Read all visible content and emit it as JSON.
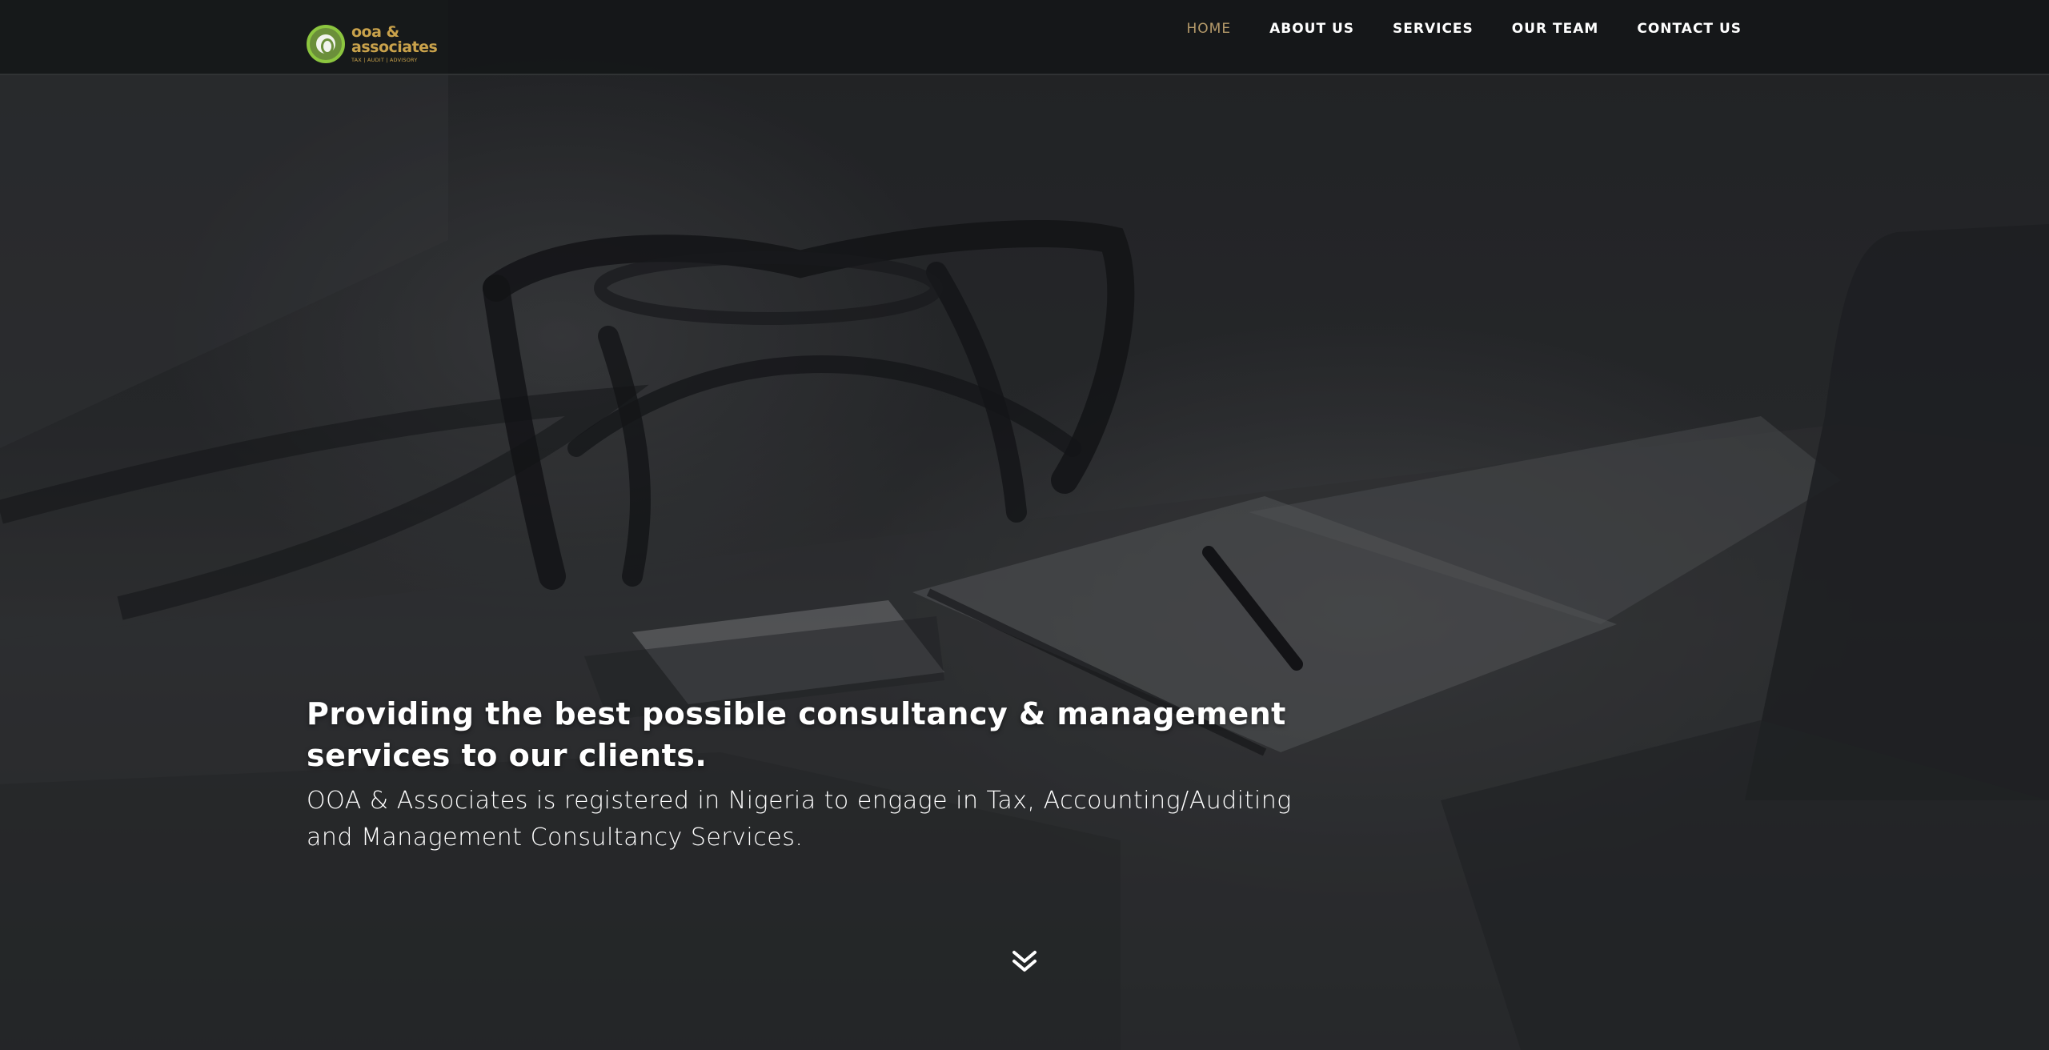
{
  "brand": {
    "logo_line1": "ooa &",
    "logo_line2": "associates",
    "tagline": "TAX | AUDIT | ADVISORY",
    "colors": {
      "gold": "#c9a24b",
      "green": "#8cc63f",
      "nav_active": "#b59a6a"
    }
  },
  "nav": {
    "items": [
      {
        "label": "HOME",
        "active": true
      },
      {
        "label": "ABOUT US",
        "active": false
      },
      {
        "label": "SERVICES",
        "active": false
      },
      {
        "label": "OUR TEAM",
        "active": false
      },
      {
        "label": "CONTACT US",
        "active": false
      }
    ]
  },
  "hero": {
    "headline": "Providing the best possible consultancy & management services to our clients.",
    "description": "OOA & Associates is registered in Nigeria to engage in Tax, Accounting/Auditing and Management Consultancy Services."
  },
  "icons": {
    "scroll": "double-chevron-down-icon"
  }
}
